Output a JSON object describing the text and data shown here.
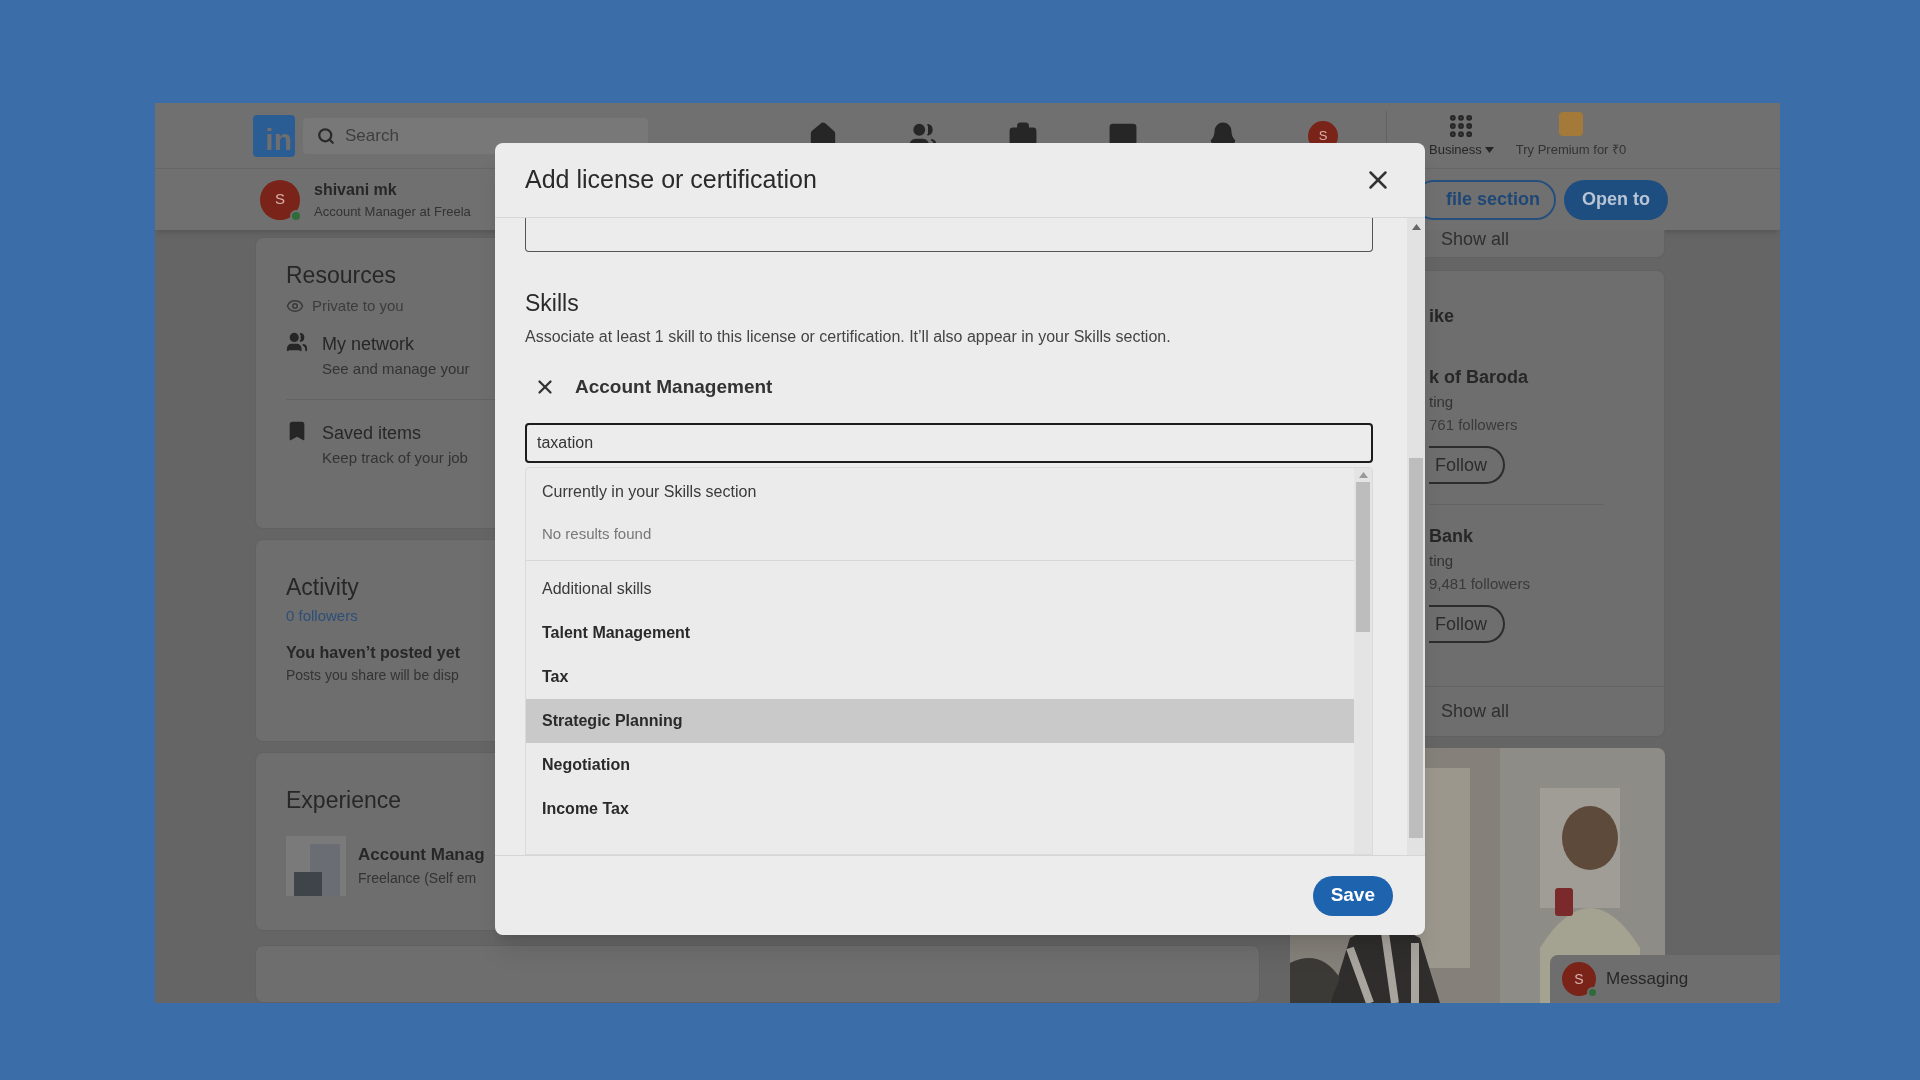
{
  "navbar": {
    "logo": "in",
    "search": {
      "placeholder": "Search"
    },
    "avatar_letter": "S",
    "business_label": "Business",
    "premium_label": "Try Premium for ₹0"
  },
  "profile_bar": {
    "avatar_letter": "S",
    "name": "shivani mk",
    "headline": "Account Manager at Freela",
    "buttons": [
      {
        "label": "file section",
        "kind": "outline"
      },
      {
        "label": "Open to",
        "kind": "primary"
      }
    ]
  },
  "resources": {
    "title": "Resources",
    "privacy": "Private to you",
    "items": [
      {
        "kind": "network",
        "title": "My network",
        "subtitle": "See and manage your"
      },
      {
        "kind": "saved",
        "title": "Saved items",
        "subtitle": "Keep track of your job"
      }
    ]
  },
  "activity": {
    "title": "Activity",
    "followers": "0 followers",
    "empty_title": "You haven’t posted yet",
    "empty_text": "Posts you share will be disp"
  },
  "experience": {
    "title": "Experience",
    "items": [
      {
        "title": "Account Manag",
        "subtitle": "Freelance (Self em"
      }
    ]
  },
  "right_column": {
    "top_show_all": "Show all",
    "card_title": "ike",
    "pages": [
      {
        "name": "k of Baroda",
        "industry": "ting",
        "followers": "761 followers",
        "button": "Follow"
      },
      {
        "name": "Bank",
        "industry": "ting",
        "followers": "9,481 followers",
        "button": "Follow"
      }
    ],
    "show_all": "Show all"
  },
  "messaging": {
    "avatar_letter": "S",
    "label": "Messaging"
  },
  "modal": {
    "title": "Add license or certification",
    "section_title": "Skills",
    "description": "Associate at least 1 skill to this license or certification. It’ll also appear in your Skills section.",
    "chosen_skills": [
      "Account Management"
    ],
    "skill_input": {
      "value": "taxation"
    },
    "dropdown": [
      {
        "heading": "Currently in your Skills section",
        "empty_text": "No results found"
      },
      {
        "heading": "Additional skills",
        "items": [
          {
            "label": "Talent Management",
            "selected": false
          },
          {
            "label": "Tax",
            "selected": false
          },
          {
            "label": "Strategic Planning",
            "selected": true
          },
          {
            "label": "Negotiation",
            "selected": false
          },
          {
            "label": "Income Tax",
            "selected": false
          }
        ]
      }
    ],
    "save_button": "Save"
  }
}
